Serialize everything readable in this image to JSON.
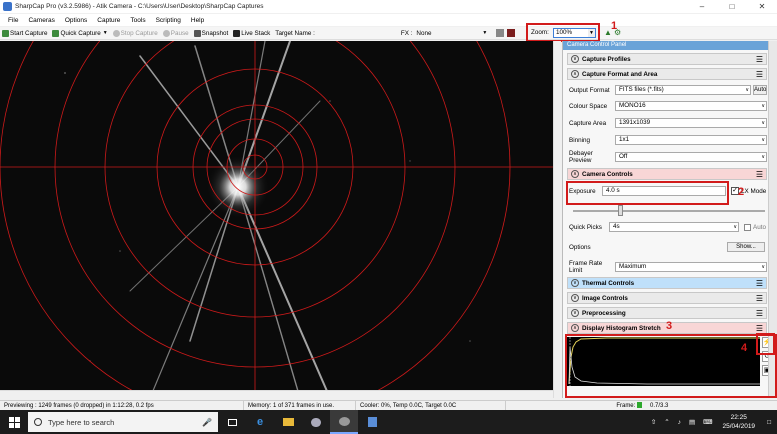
{
  "window": {
    "title": "SharpCap Pro (v3.2.5986) - Atik Camera - C:\\Users\\User\\Desktop\\SharpCap Captures",
    "controls": [
      "minimize",
      "maximize",
      "close"
    ]
  },
  "menu": [
    "File",
    "Cameras",
    "Options",
    "Capture",
    "Tools",
    "Scripting",
    "Help"
  ],
  "toolbar": {
    "start_capture": "Start Capture",
    "quick_capture": "Quick Capture",
    "stop_capture": "Stop Capture",
    "pause": "Pause",
    "snapshot": "Snapshot",
    "live_stack": "Live Stack",
    "target_name_label": "Target Name :",
    "fx_label": "FX :",
    "fx_value": "None",
    "zoom_label": "Zoom:",
    "zoom_value": "100%"
  },
  "annotations": {
    "n1": "1",
    "n2": "2",
    "n3": "3",
    "n4": "4"
  },
  "viewer": {
    "reticle_color": "#cc1a1a",
    "background": "#0a0a0a"
  },
  "panel": {
    "title": "Camera Control Panel",
    "sections": {
      "capture_profiles": "Capture Profiles",
      "capture_format": "Capture Format and Area",
      "camera_controls": "Camera Controls",
      "thermal_controls": "Thermal Controls",
      "image_controls": "Image Controls",
      "preprocessing": "Preprocessing",
      "display_histogram": "Display Histogram Stretch"
    },
    "fields": {
      "output_format_label": "Output Format",
      "output_format_value": "FITS files (*.fits)",
      "auto_label": "Auto",
      "colour_space_label": "Colour Space",
      "colour_space_value": "MONO16",
      "capture_area_label": "Capture Area",
      "capture_area_value": "1391x1039",
      "binning_label": "Binning",
      "binning_value": "1x1",
      "debayer_label": "Debayer Preview",
      "debayer_value": "Off",
      "exposure_label": "Exposure",
      "exposure_value": "4.0 s",
      "lx_mode_label": "LX Mode",
      "quick_picks_label": "Quick Picks",
      "quick_picks_value": "4s",
      "auto2_label": "Auto",
      "options_label": "Options",
      "show_button": "Show...",
      "frame_rate_label": "Frame Rate Limit",
      "frame_rate_value": "Maximum"
    },
    "hist_tools": [
      "auto-stretch-icon",
      "reset-icon",
      "save-icon"
    ]
  },
  "status": {
    "previewing": "Previewing : 1249 frames (0 dropped) in 1:12:28, 0.2 fps",
    "memory": "Memory: 1 of 371 frames in use.",
    "cooler": "Cooler: 0%, Temp 0.0C, Target 0.0C",
    "frame_label": "Frame:",
    "fraction": "0.7/3.3"
  },
  "taskbar": {
    "search_placeholder": "Type here to search",
    "time": "22:25",
    "date": "25/04/2019"
  }
}
